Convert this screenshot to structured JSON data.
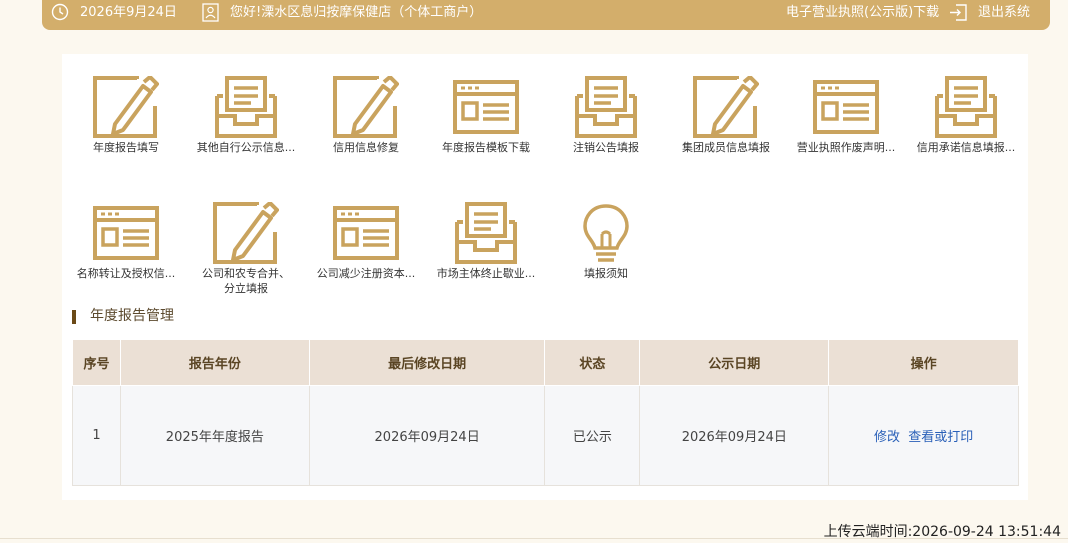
{
  "header": {
    "date": "2026年9月24日",
    "greeting": "您好!溧水区息归按摩保健店（个体工商户）",
    "download_license": "电子营业执照(公示版)下载",
    "logout": "退出系统"
  },
  "tiles": [
    {
      "label": "年度报告填写",
      "icon": "pencil-edit-icon"
    },
    {
      "label": "其他自行公示信息...",
      "icon": "inbox-tray-icon"
    },
    {
      "label": "信用信息修复",
      "icon": "pencil-edit-icon"
    },
    {
      "label": "年度报告模板下载",
      "icon": "window-form-icon"
    },
    {
      "label": "注销公告填报",
      "icon": "inbox-tray-icon"
    },
    {
      "label": "集团成员信息填报",
      "icon": "pencil-edit-icon"
    },
    {
      "label": "营业执照作废声明...",
      "icon": "window-form-icon"
    },
    {
      "label": "信用承诺信息填报...",
      "icon": "inbox-tray-icon"
    },
    {
      "label": "名称转让及授权信...",
      "icon": "window-form-icon"
    },
    {
      "label": "公司和农专合并、分立填报",
      "icon": "pencil-edit-icon"
    },
    {
      "label": "公司减少注册资本...",
      "icon": "window-form-icon"
    },
    {
      "label": "市场主体终止歇业...",
      "icon": "inbox-tray-icon"
    },
    {
      "label": "填报须知",
      "icon": "lightbulb-icon"
    }
  ],
  "section": {
    "title": "年度报告管理"
  },
  "table": {
    "headers": [
      "序号",
      "报告年份",
      "最后修改日期",
      "状态",
      "公示日期",
      "操作"
    ],
    "rows": [
      {
        "no": "1",
        "year": "2025年年度报告",
        "modified": "2026年09月24日",
        "status": "已公示",
        "published": "2026年09月24日",
        "edit": "修改",
        "view": "查看或打印"
      }
    ]
  },
  "footer": {
    "upload_time": "上传云端时间:2026-09-24 13:51:44"
  },
  "colors": {
    "accent": "#d3ae6b",
    "icon_gold": "#c9a35e",
    "dark_gold": "#a98a45",
    "link": "#2a60b8"
  }
}
